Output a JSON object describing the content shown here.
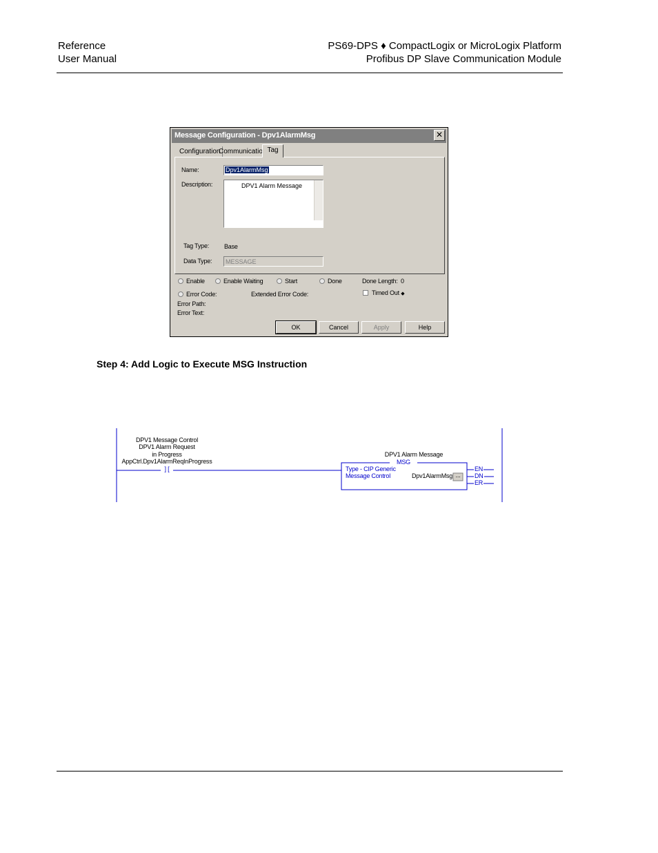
{
  "header": {
    "left_line1": "Reference",
    "left_line2": "User Manual",
    "right_line1": "PS69-DPS ♦ CompactLogix or MicroLogix Platform",
    "right_line2": "Profibus DP Slave Communication Module"
  },
  "dialog": {
    "title": "Message Configuration - Dpv1AlarmMsg",
    "close_glyph": "✕",
    "tabs": [
      "Configuration",
      "Communication",
      "Tag"
    ],
    "name_label": "Name:",
    "name_value": "Dpv1AlarmMsg",
    "description_label": "Description:",
    "description_value": "DPV1 Alarm Message",
    "tag_type_label": "Tag Type:",
    "tag_type_value": "Base",
    "data_type_label": "Data Type:",
    "data_type_value": "MESSAGE",
    "status": {
      "enable": "Enable",
      "enable_waiting": "Enable Waiting",
      "start": "Start",
      "done": "Done",
      "done_length_label": "Done Length:",
      "done_length_value": "0",
      "error_code": "Error Code:",
      "extended_error_code": "Extended Error Code:",
      "timed_out": "Timed Out",
      "timed_out_glyph": "◆",
      "error_path": "Error Path:",
      "error_text": "Error Text:"
    },
    "buttons": {
      "ok": "OK",
      "cancel": "Cancel",
      "apply": "Apply",
      "help": "Help"
    }
  },
  "step_heading": "Step 4: Add Logic to Execute MSG Instruction",
  "ladder": {
    "contact_line1": "DPV1 Message Control",
    "contact_line2": "DPV1 Alarm Request",
    "contact_line3": "in Progress",
    "contact_tag": "AppCtrl.Dpv1AlarmReqInProgress",
    "contact_symbol": "] [",
    "msg_desc": "DPV1 Alarm Message",
    "msg_name": "MSG",
    "msg_type": "Type - CIP Generic",
    "msg_control_label": "Message Control",
    "msg_control_value": "Dpv1AlarmMsg",
    "msg_button": "...",
    "outputs": [
      "EN",
      "DN",
      "ER"
    ]
  }
}
